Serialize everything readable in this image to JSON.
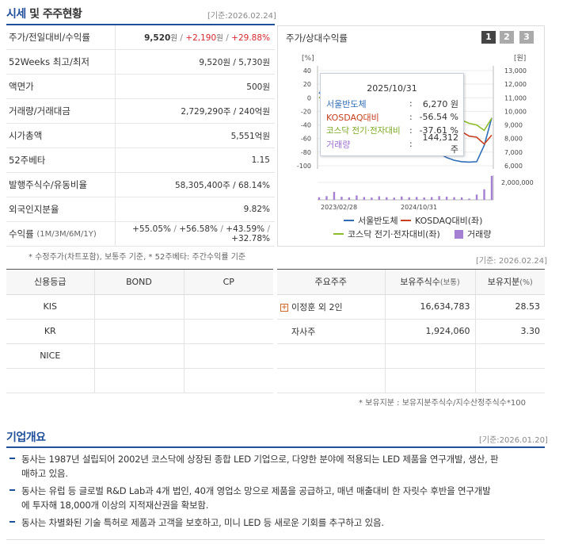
{
  "price_section": {
    "title_part1": "시세",
    "title_part2": " 및 주주현황",
    "base_date": "[기준:2026.02.24]",
    "rows": [
      {
        "label": "주가/전일대비/수익률",
        "price": "9,520",
        "price_unit": "원",
        "change": "+2,190",
        "change_unit": "원",
        "rate": "+29.88%"
      },
      {
        "label": "52Weeks 최고/최저",
        "value": "9,520원 / 5,730원"
      },
      {
        "label": "액면가",
        "value": "500원"
      },
      {
        "label": "거래량/거래대금",
        "value": "2,729,290주 / 240억원"
      },
      {
        "label": "시가총액",
        "value": "5,551억원"
      },
      {
        "label": "52주베타",
        "value": "1.15"
      },
      {
        "label": "발행주식수/유동비율",
        "value": "58,305,400주 / 68.14%"
      },
      {
        "label": "외국인지분율",
        "value": "9.82%"
      },
      {
        "label": "수익률",
        "label_sub": "(1M/3M/6M/1Y)",
        "r1": "+55.05%",
        "r2": "+56.58%",
        "r3": "+43.59%",
        "r4": "+32.78%"
      }
    ],
    "footnote": "* 수정주가(차트포함), 보통주 기준, * 52주베타: 주간수익률 기준"
  },
  "chart_panel": {
    "title": "주가/상대수익률",
    "buttons": [
      "1",
      "2",
      "3"
    ],
    "tooltip": {
      "date": "2025/10/31",
      "rows": [
        {
          "name": "서울반도체",
          "sep": ":",
          "value": "6,270 원"
        },
        {
          "name": "KOSDAQ대비",
          "sep": ":",
          "value": "-56.54 %"
        },
        {
          "name": "코스닥 전기·전자대비",
          "sep": ":",
          "value": "-37.61 %"
        },
        {
          "name": "거래량",
          "sep": ":",
          "value": "144,312 주"
        }
      ]
    },
    "legend": [
      {
        "label": "서울반도체",
        "color": "#2f6db6"
      },
      {
        "label": "KOSDAQ대비(좌)",
        "color": "#c8401e"
      },
      {
        "label": "코스닥 전기·전자대비(좌)",
        "color": "#8dbd2a"
      },
      {
        "label": "거래량",
        "color": "#a57fd1"
      }
    ]
  },
  "chart_data": {
    "type": "line",
    "left_unit": "[%]",
    "right_unit": "[원]",
    "left_ticks": [
      "40",
      "20",
      "0",
      "-20",
      "-40",
      "-60",
      "-80",
      "-100"
    ],
    "left_ylim": [
      -100,
      40
    ],
    "right_ticks": [
      "13,000",
      "12,000",
      "11,000",
      "10,000",
      "9,000",
      "8,000",
      "7,000",
      "6,000"
    ],
    "right_ylim": [
      6000,
      13000
    ],
    "volume_tick": "2,000,000",
    "x_ticks": [
      "2023/02/28",
      "2024/10/31"
    ],
    "series": [
      {
        "name": "서울반도체",
        "axis": "right",
        "color": "#2f6db6",
        "values": [
          11300,
          12100,
          11500,
          10900,
          10600,
          10200,
          9900,
          9400,
          9100,
          8700,
          8400,
          8100,
          7800,
          7500,
          7300,
          7100,
          6900,
          6600,
          6400,
          6300,
          6270,
          6300,
          7500,
          9520
        ]
      },
      {
        "name": "KOSDAQ대비",
        "axis": "left",
        "color": "#c8401e",
        "values": [
          0,
          3,
          -2,
          -6,
          -10,
          -14,
          -17,
          -20,
          -22,
          -24,
          -26,
          -28,
          -30,
          -32,
          -35,
          -38,
          -42,
          -45,
          -48,
          -50,
          -56.5,
          -58,
          -68,
          -55
        ]
      },
      {
        "name": "코스닥 전기·전자대비",
        "axis": "left",
        "color": "#8dbd2a",
        "values": [
          0,
          4,
          1,
          -2,
          -5,
          -8,
          -10,
          -12,
          -14,
          -15,
          -16,
          -17,
          -18,
          -20,
          -22,
          -24,
          -26,
          -28,
          -30,
          -33,
          -37.6,
          -40,
          -48,
          -30
        ]
      },
      {
        "name": "거래량",
        "axis": "volume",
        "color": "#a57fd1",
        "values": [
          300000,
          420000,
          900000,
          350000,
          280000,
          500000,
          320000,
          260000,
          400000,
          300000,
          250000,
          380000,
          290000,
          330000,
          270000,
          310000,
          420000,
          360000,
          300000,
          280000,
          144312,
          600000,
          1200000,
          2729290
        ]
      }
    ]
  },
  "credit_table": {
    "headers": [
      "신용등급",
      "BOND",
      "CP"
    ],
    "rows": [
      [
        "KIS",
        "",
        ""
      ],
      [
        "KR",
        "",
        ""
      ],
      [
        "NICE",
        "",
        ""
      ],
      [
        "",
        "",
        ""
      ]
    ]
  },
  "holder_section": {
    "base_date": "[기준: 2026.02.24]",
    "headers": [
      "주요주주",
      "보유주식수",
      "(보통)",
      "보유지분",
      "(%)"
    ],
    "rows": [
      {
        "name": "이정훈 외 2인",
        "shares": "16,634,783",
        "ratio": "28.53",
        "expandable": true
      },
      {
        "name": "자사주",
        "shares": "1,924,060",
        "ratio": "3.30",
        "expandable": false
      },
      {
        "name": "",
        "shares": "",
        "ratio": "",
        "expandable": false
      },
      {
        "name": "",
        "shares": "",
        "ratio": "",
        "expandable": false
      }
    ],
    "footnote": "* 보유지분 : 보유지분주식수/지수산정주식수*100"
  },
  "company_overview": {
    "title": "기업개요",
    "base_date": "[기준:2026.01.20]",
    "items": [
      {
        "line1": "동사는 1987년 설립되어 2002년 코스닥에 상장된 종합 LED 기업으로, 다양한 분야에 적용되는 LED 제품을 연구개발, 생산, 판",
        "line2": "매하고 있음."
      },
      {
        "line1": "동사는 유럽 등 글로벌 R&D Lab과 4개 법인, 40개 영업소 망으로 제품을 공급하고, 매년 매출대비 한 자릿수 후반을 연구개발",
        "line2": "에 투자해 18,000개 이상의 지적재산권을 확보함."
      },
      {
        "line1": "동사는 차별화된 기술 특허로 제품과 고객을 보호하고, 미니 LED 등 새로운 기회를 추구하고 있음.",
        "line2": ""
      }
    ]
  }
}
